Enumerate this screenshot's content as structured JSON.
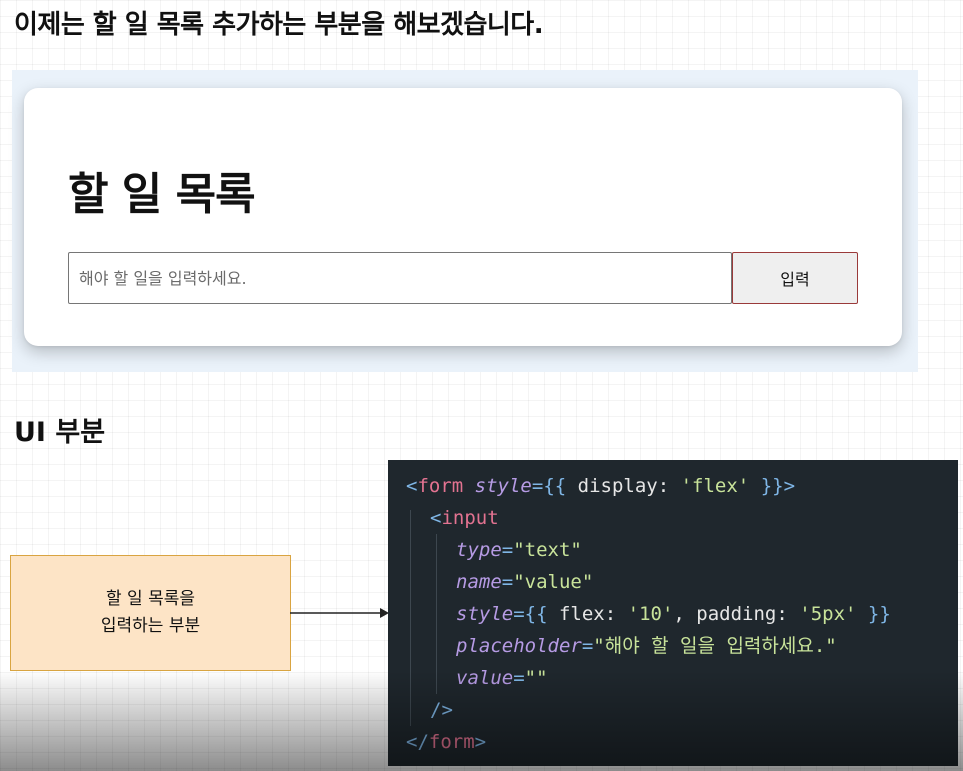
{
  "heading": "이제는 할 일 목록 추가하는 부분을 해보겠습니다.",
  "preview": {
    "title": "할 일 목록",
    "input_placeholder": "해야 할 일을 입력하세요.",
    "input_value": "",
    "submit_label": "입력"
  },
  "section_title": "UI 부분",
  "callout": {
    "line1": "할 일 목록을",
    "line2": "입력하는 부분"
  },
  "code": {
    "l1": [
      "<",
      "form",
      "style",
      "={{ ",
      "display",
      ": ",
      "'flex'",
      " }}>"
    ],
    "l2": [
      "<",
      "input"
    ],
    "l3": [
      "type",
      "=",
      "\"text\""
    ],
    "l4": [
      "name",
      "=",
      "\"value\""
    ],
    "l5": [
      "style",
      "={{ ",
      "flex",
      ": ",
      "'10'",
      ", ",
      "padding",
      ": ",
      "'5px'",
      " }}"
    ],
    "l6": [
      "placeholder",
      "=",
      "\"해야 할 일을 입력하세요.\""
    ],
    "l7": [
      "value",
      "=",
      "\"\""
    ],
    "l8": [
      "/>"
    ],
    "l9": [
      "</",
      "form",
      ">"
    ]
  },
  "colors": {
    "callout_bg": "#fde4c6",
    "callout_border": "#d9a441",
    "code_bg": "#1f272d",
    "tag_name": "#e37391",
    "attr_name": "#b69be4",
    "string": "#c8e39a",
    "bracket": "#7fb6e6",
    "button_border": "#9a3a3a"
  }
}
